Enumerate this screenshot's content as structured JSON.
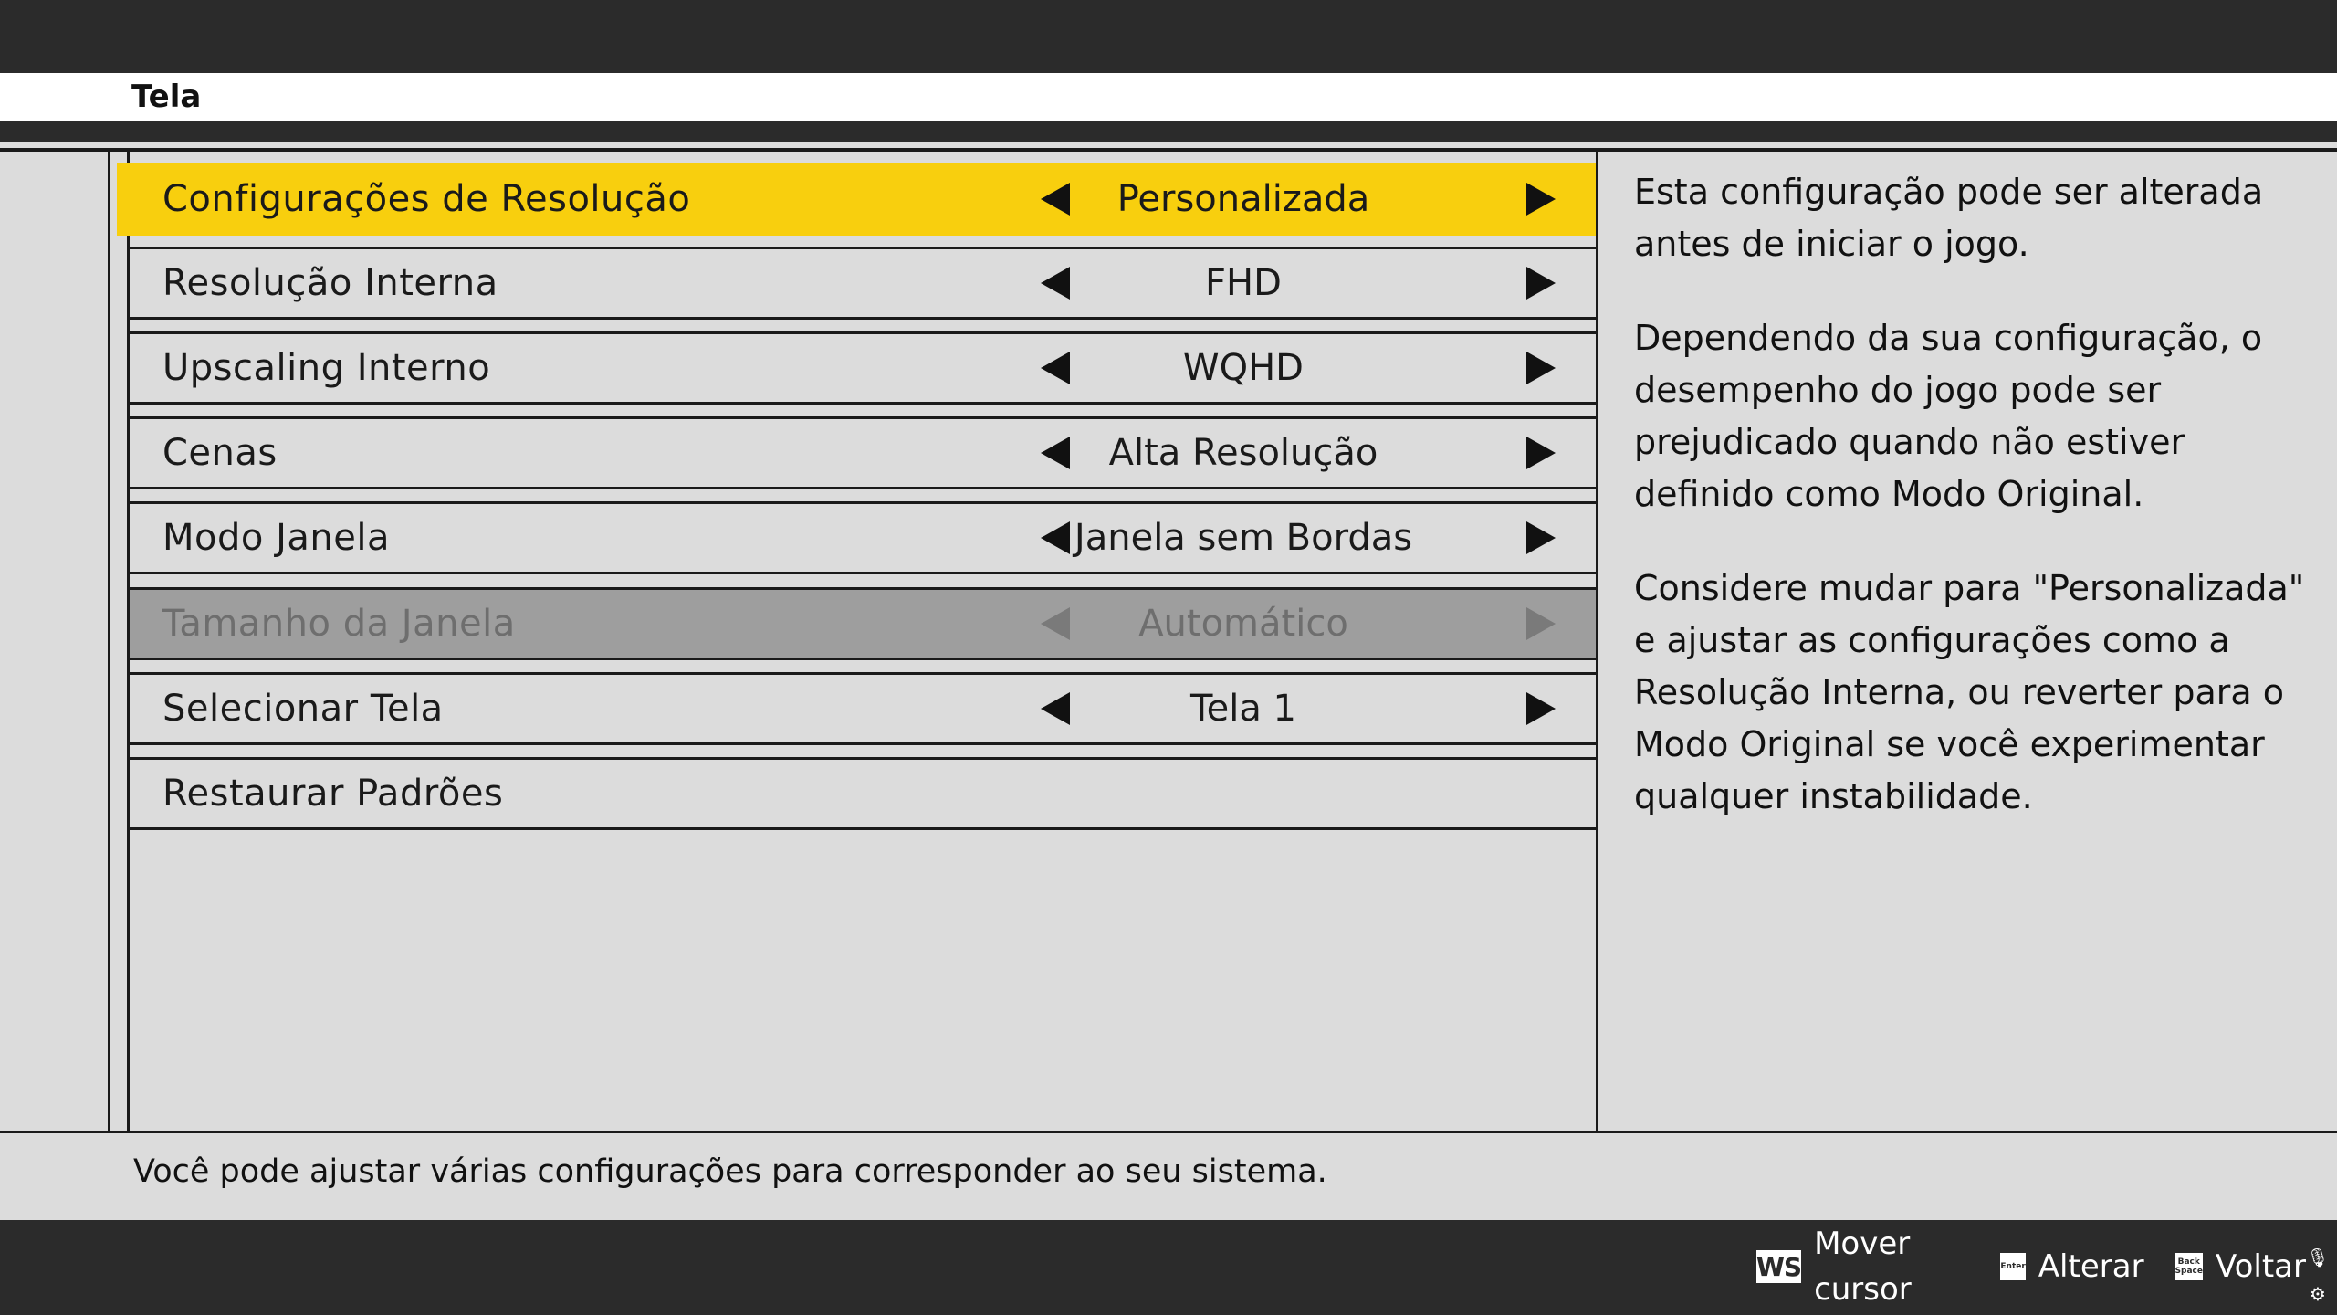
{
  "header": {
    "title": "Tela"
  },
  "settings": [
    {
      "label": "Configurações de Resolução",
      "value": "Personalizada",
      "state": "selected"
    },
    {
      "label": "Resolução Interna",
      "value": "FHD",
      "state": "normal"
    },
    {
      "label": "Upscaling Interno",
      "value": "WQHD",
      "state": "normal"
    },
    {
      "label": "Cenas",
      "value": "Alta Resolução",
      "state": "normal"
    },
    {
      "label": "Modo Janela",
      "value": "Janela sem Bordas",
      "state": "normal"
    },
    {
      "label": "Tamanho da Janela",
      "value": "Automático",
      "state": "disabled"
    },
    {
      "label": "Selecionar Tela",
      "value": "Tela 1",
      "state": "normal"
    },
    {
      "label": "Restaurar Padrões",
      "value": "",
      "state": "normal"
    }
  ],
  "description": {
    "paragraphs": [
      "Esta configuração pode ser alterada antes de iniciar o jogo.",
      "Dependendo da sua configuração, o desempenho do jogo pode ser prejudicado quando não estiver definido como Modo Original.",
      "Considere mudar para \"Personalizada\" e ajustar as configurações como a Resolução Interna, ou reverter para o Modo Original se você experimentar qualquer instabilidade."
    ]
  },
  "footer": {
    "hint": "Você pode ajustar várias configurações para corresponder ao seu sistema.",
    "controls": [
      {
        "key": "WS",
        "label": "Mover cursor"
      },
      {
        "key": "Enter",
        "label": "Alterar"
      },
      {
        "key": "Back Space",
        "label": "Voltar"
      }
    ]
  },
  "colors": {
    "highlight": "#f8cf0e",
    "background": "#dcdcdc",
    "dark_bar": "#2b2b2b",
    "disabled_row": "#9e9e9e"
  },
  "icons": [
    "arrow-left-icon",
    "arrow-right-icon",
    "microphone-icon",
    "settings-icon"
  ]
}
